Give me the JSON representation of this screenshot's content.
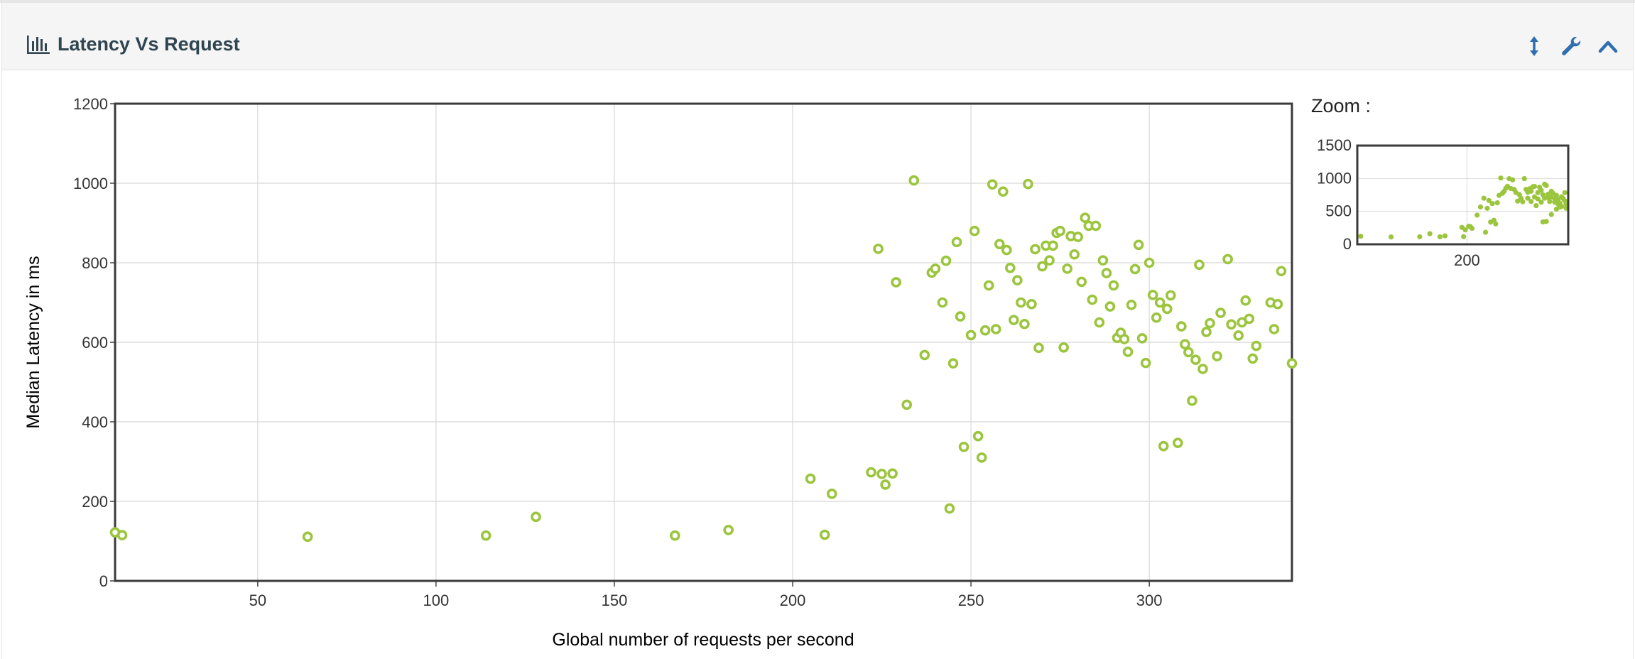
{
  "panel": {
    "title": "Latency Vs Request",
    "icons": {
      "title_icon": "bar-chart-icon",
      "resize": "vertical-resize-icon",
      "settings": "wrench-icon",
      "collapse": "chevron-up-icon"
    },
    "accent_color": "#2f4550",
    "button_color": "#2f6fb0"
  },
  "zoom": {
    "label": "Zoom :"
  },
  "chart_data": [
    {
      "type": "scatter",
      "xlabel": "Global number of requests per second",
      "ylabel": "Median Latency in ms",
      "xlim": [
        10,
        340
      ],
      "ylim": [
        0,
        1200
      ],
      "xticks": [
        50,
        100,
        150,
        200,
        250,
        300
      ],
      "yticks": [
        0,
        200,
        400,
        600,
        800,
        1000,
        1200
      ],
      "grid": true,
      "marker": "hollow-circle",
      "color": "#9bc53d",
      "points": [
        [
          10,
          122
        ],
        [
          12,
          115
        ],
        [
          64,
          111
        ],
        [
          114,
          114
        ],
        [
          128,
          161
        ],
        [
          167,
          114
        ],
        [
          182,
          128
        ],
        [
          205,
          257
        ],
        [
          209,
          116
        ],
        [
          211,
          219
        ],
        [
          222,
          273
        ],
        [
          224,
          835
        ],
        [
          225,
          269
        ],
        [
          226,
          242
        ],
        [
          228,
          270
        ],
        [
          229,
          751
        ],
        [
          232,
          443
        ],
        [
          234,
          1007
        ],
        [
          237,
          568
        ],
        [
          239,
          775
        ],
        [
          240,
          785
        ],
        [
          242,
          700
        ],
        [
          243,
          805
        ],
        [
          244,
          182
        ],
        [
          245,
          547
        ],
        [
          246,
          852
        ],
        [
          247,
          665
        ],
        [
          248,
          337
        ],
        [
          250,
          618
        ],
        [
          251,
          880
        ],
        [
          252,
          364
        ],
        [
          253,
          310
        ],
        [
          254,
          630
        ],
        [
          255,
          743
        ],
        [
          256,
          997
        ],
        [
          257,
          633
        ],
        [
          258,
          847
        ],
        [
          259,
          979
        ],
        [
          260,
          832
        ],
        [
          261,
          787
        ],
        [
          262,
          656
        ],
        [
          263,
          756
        ],
        [
          264,
          700
        ],
        [
          265,
          646
        ],
        [
          266,
          998
        ],
        [
          267,
          696
        ],
        [
          268,
          834
        ],
        [
          269,
          586
        ],
        [
          270,
          791
        ],
        [
          271,
          843
        ],
        [
          272,
          806
        ],
        [
          273,
          843
        ],
        [
          274,
          875
        ],
        [
          275,
          880
        ],
        [
          276,
          587
        ],
        [
          277,
          785
        ],
        [
          278,
          867
        ],
        [
          279,
          821
        ],
        [
          280,
          865
        ],
        [
          281,
          752
        ],
        [
          282,
          913
        ],
        [
          283,
          893
        ],
        [
          284,
          707
        ],
        [
          285,
          893
        ],
        [
          286,
          650
        ],
        [
          287,
          806
        ],
        [
          288,
          774
        ],
        [
          289,
          690
        ],
        [
          290,
          743
        ],
        [
          291,
          611
        ],
        [
          292,
          624
        ],
        [
          293,
          608
        ],
        [
          294,
          576
        ],
        [
          295,
          694
        ],
        [
          296,
          784
        ],
        [
          297,
          845
        ],
        [
          298,
          610
        ],
        [
          299,
          548
        ],
        [
          300,
          800
        ],
        [
          301,
          719
        ],
        [
          302,
          662
        ],
        [
          303,
          700
        ],
        [
          304,
          339
        ],
        [
          305,
          684
        ],
        [
          306,
          718
        ],
        [
          308,
          347
        ],
        [
          309,
          640
        ],
        [
          310,
          595
        ],
        [
          311,
          575
        ],
        [
          312,
          453
        ],
        [
          313,
          556
        ],
        [
          314,
          795
        ],
        [
          315,
          533
        ],
        [
          316,
          626
        ],
        [
          317,
          648
        ],
        [
          319,
          565
        ],
        [
          320,
          674
        ],
        [
          322,
          809
        ],
        [
          323,
          645
        ],
        [
          325,
          617
        ],
        [
          326,
          650
        ],
        [
          327,
          705
        ],
        [
          328,
          659
        ],
        [
          329,
          559
        ],
        [
          330,
          591
        ],
        [
          334,
          700
        ],
        [
          335,
          633
        ],
        [
          336,
          696
        ],
        [
          337,
          779
        ],
        [
          340,
          547
        ]
      ]
    },
    {
      "type": "scatter",
      "title": "Zoom :",
      "xlim": [
        135,
        260
      ],
      "ylim": [
        0,
        1500
      ],
      "xticks": [
        200
      ],
      "yticks": [
        0,
        500,
        1000,
        1500
      ],
      "grid": true,
      "marker": "filled-circle",
      "color": "#9bc53d",
      "points": [
        [
          137,
          122
        ],
        [
          155,
          111
        ],
        [
          172,
          114
        ],
        [
          178,
          161
        ],
        [
          184,
          114
        ],
        [
          187,
          128
        ],
        [
          197,
          257
        ],
        [
          198,
          116
        ],
        [
          199,
          219
        ],
        [
          201,
          273
        ],
        [
          202,
          269
        ],
        [
          203,
          242
        ],
        [
          206,
          443
        ],
        [
          208,
          568
        ],
        [
          210,
          700
        ],
        [
          211,
          182
        ],
        [
          212,
          547
        ],
        [
          213,
          665
        ],
        [
          214,
          337
        ],
        [
          215,
          618
        ],
        [
          216,
          364
        ],
        [
          217,
          310
        ],
        [
          218,
          630
        ],
        [
          219,
          743
        ],
        [
          220,
          1007
        ],
        [
          221,
          775
        ],
        [
          222,
          805
        ],
        [
          223,
          852
        ],
        [
          224,
          880
        ],
        [
          225,
          997
        ],
        [
          226,
          847
        ],
        [
          227,
          979
        ],
        [
          228,
          832
        ],
        [
          229,
          787
        ],
        [
          230,
          656
        ],
        [
          231,
          756
        ],
        [
          232,
          700
        ],
        [
          233,
          646
        ],
        [
          234,
          998
        ],
        [
          235,
          834
        ],
        [
          236,
          791
        ],
        [
          237,
          843
        ],
        [
          238,
          806
        ],
        [
          239,
          875
        ],
        [
          240,
          880
        ],
        [
          241,
          587
        ],
        [
          242,
          785
        ],
        [
          243,
          867
        ],
        [
          244,
          821
        ],
        [
          245,
          752
        ],
        [
          246,
          913
        ],
        [
          247,
          893
        ],
        [
          248,
          707
        ],
        [
          249,
          650
        ],
        [
          250,
          806
        ],
        [
          251,
          774
        ],
        [
          252,
          690
        ],
        [
          253,
          743
        ],
        [
          254,
          611
        ],
        [
          255,
          624
        ],
        [
          256,
          576
        ],
        [
          257,
          694
        ],
        [
          258,
          784
        ],
        [
          259,
          610
        ],
        [
          260,
          548
        ],
        [
          236,
          700
        ],
        [
          238,
          650
        ],
        [
          240,
          720
        ],
        [
          242,
          690
        ],
        [
          244,
          640
        ],
        [
          246,
          700
        ],
        [
          248,
          760
        ],
        [
          250,
          720
        ],
        [
          252,
          640
        ],
        [
          254,
          680
        ],
        [
          256,
          720
        ],
        [
          258,
          660
        ],
        [
          245,
          339
        ],
        [
          247,
          347
        ],
        [
          250,
          453
        ],
        [
          253,
          533
        ],
        [
          255,
          565
        ]
      ]
    }
  ]
}
